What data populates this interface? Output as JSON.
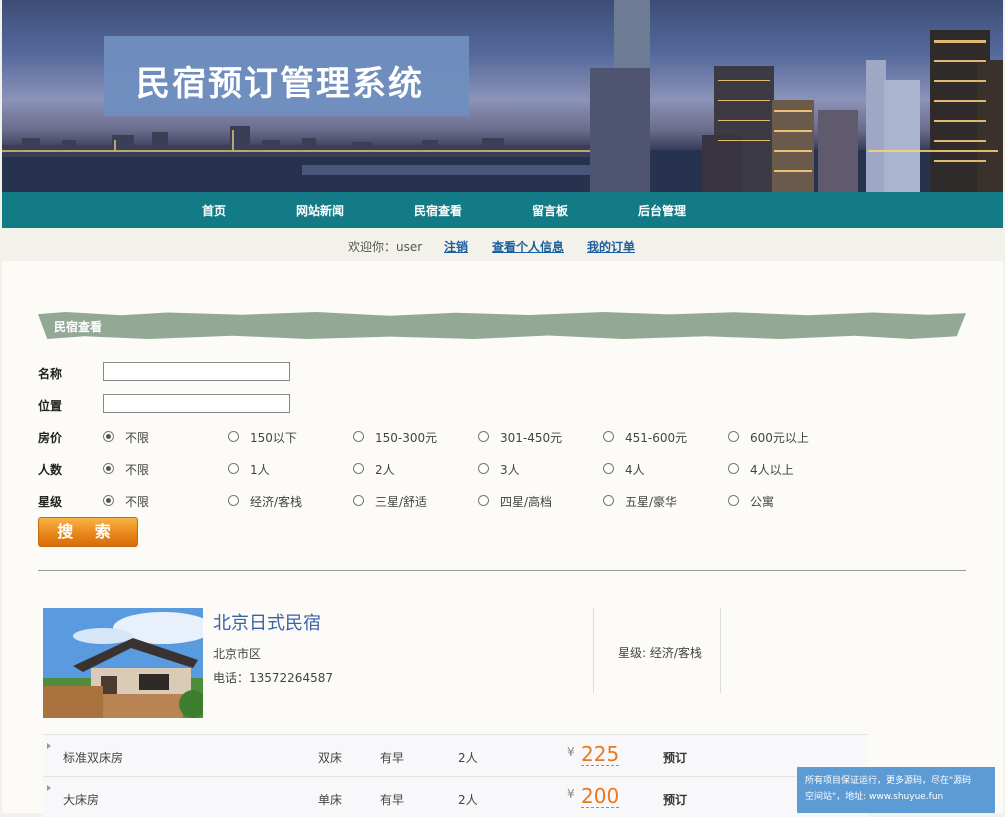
{
  "banner": {
    "title": "民宿预订管理系统"
  },
  "nav": {
    "items": [
      "首页",
      "网站新闻",
      "民宿查看",
      "留言板",
      "后台管理"
    ]
  },
  "welcome": {
    "greeting": "欢迎你：user",
    "logout": "注销",
    "profile": "查看个人信息",
    "orders": "我的订单"
  },
  "search": {
    "section_title": "民宿查看",
    "name_label": "名称",
    "name_value": "",
    "location_label": "位置",
    "location_value": "",
    "price": {
      "label": "房价",
      "selected": 0,
      "options": [
        "不限",
        "150以下",
        "150-300元",
        "301-450元",
        "451-600元",
        "600元以上"
      ]
    },
    "people": {
      "label": "人数",
      "selected": 0,
      "options": [
        "不限",
        "1人",
        "2人",
        "3人",
        "4人",
        "4人以上"
      ]
    },
    "stars": {
      "label": "星级",
      "selected": 0,
      "options": [
        "不限",
        "经济/客栈",
        "三星/舒适",
        "四星/高档",
        "五星/豪华",
        "公寓"
      ]
    },
    "button_label": "搜 索"
  },
  "listing": {
    "name": "北京日式民宿",
    "location": "北京市区",
    "phone": "电话：13572264587",
    "star": "星级: 经济/客栈",
    "rooms": [
      {
        "name": "标准双床房",
        "bed": "双床",
        "breakfast": "有早",
        "people": "2人",
        "currency": "¥",
        "price": "225",
        "book": "预订"
      },
      {
        "name": "大床房",
        "bed": "单床",
        "breakfast": "有早",
        "people": "2人",
        "currency": "¥",
        "price": "200",
        "book": "预订"
      }
    ]
  },
  "watermark": {
    "line1": "所有项目保证运行，更多源码，尽在\"源码",
    "line2": "空间站\"，地址: www.shuyue.fun"
  },
  "colors": {
    "nav": "#137b86",
    "accent_price": "#e87a1e",
    "link": "#1b5e9e",
    "section_bar": "#93a996"
  }
}
